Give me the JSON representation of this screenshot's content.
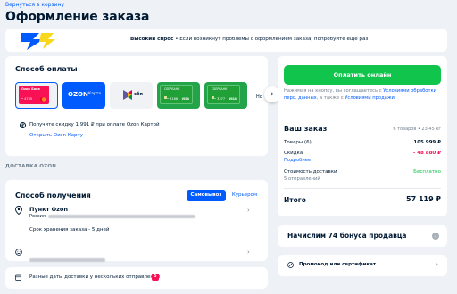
{
  "header": {
    "back_link": "Вернуться в корзину",
    "title": "Оформление заказа"
  },
  "banner": {
    "strong": "Высокий спрос",
    "text": " •  Если возникнут проблемы с оформлением заказа, попробуйте ещё раз"
  },
  "payment": {
    "title": "Способ оплаты",
    "methods": [
      {
        "label": "Ozon Банк",
        "number": "• 4785"
      },
      {
        "label": "OZON",
        "sub": "Карта"
      },
      {
        "label": "сбп"
      },
      {
        "label": "СБЕРБАНК",
        "number": "• 3168",
        "brand": "VISA"
      },
      {
        "label": "СБЕРБАНК",
        "number": "• 3377",
        "brand": "VISA"
      }
    ],
    "partial": "Но",
    "discount_text": "Получите скидку 1 991 ₽ при оплате Ozon Картой",
    "discount_link": "Открыть Ozon Карту",
    "discount_icon": "₽"
  },
  "delivery_section_label": "ДОСТАВКА OZON",
  "delivery": {
    "title": "Способ получения",
    "tab_pickup": "Самовывоз",
    "tab_courier": "Курьером",
    "pickup_title": "Пункт Ozon",
    "pickup_country": "Россия,",
    "storage": "Срок хранения заказа - 5 дней"
  },
  "dates_note": {
    "text": "Разные даты доставки у нескольких отправлений",
    "badge": "5"
  },
  "summary": {
    "cta": "Оплатить онлайн",
    "legal_prefix": "Нажимая на кнопку, вы соглашаетесь с ",
    "legal_link1": "Условиями обработки перс. данных",
    "legal_mid": ", а также с ",
    "legal_link2": "Условиями продажи",
    "order_title": "Ваш заказ",
    "order_meta": "6 товаров • 23,45 кг",
    "goods_label": "Товары (6)",
    "goods_value": "105 999 ₽",
    "discount_label": "Скидка",
    "discount_more": "Подробнее",
    "discount_value": "- 48 880 ₽",
    "shipping_label": "Стоимость доставки",
    "shipping_sub": "5 отправлений",
    "shipping_value": "Бесплатно",
    "total_label": "Итого",
    "total_value": "57 119 ₽"
  },
  "bonus": {
    "text": "Начислим 74 бонуса продавца",
    "icon": "chevron-down"
  },
  "promo": {
    "text": "Промокод или сертификат",
    "icon": "chevron-right"
  },
  "colors": {
    "accent": "#005bff",
    "cta": "#10c44c",
    "discount": "#f91155",
    "free": "#10c44c"
  }
}
